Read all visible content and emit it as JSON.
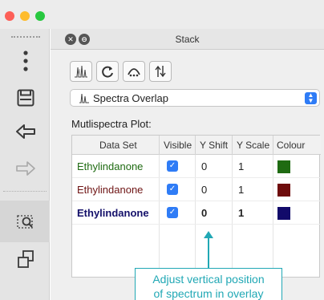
{
  "window": {
    "traffic_lights": [
      "close",
      "minimize",
      "zoom"
    ]
  },
  "left_toolbar": {
    "items": [
      {
        "name": "more",
        "icon": "vertical-dots-icon"
      },
      {
        "name": "save",
        "icon": "floppy-disk-icon"
      },
      {
        "name": "undo",
        "icon": "undo-arrow-icon"
      },
      {
        "name": "redo",
        "icon": "redo-arrow-icon"
      },
      {
        "name": "zoom-window",
        "icon": "zoom-region-icon"
      },
      {
        "name": "stack",
        "icon": "stacked-windows-icon"
      }
    ]
  },
  "panel": {
    "title": "Stack",
    "tools": [
      {
        "name": "spectra-overlay-tool",
        "icon": "overlay-spectra-icon"
      },
      {
        "name": "refresh-tool",
        "icon": "refresh-icon"
      },
      {
        "name": "peaks-tool",
        "icon": "peak-dots-icon"
      },
      {
        "name": "shift-tool",
        "icon": "vertical-shift-icon"
      }
    ],
    "mode_select": {
      "value": "Spectra Overlap",
      "icon": "spectra-overlap-icon"
    },
    "plot_label": "Mutlispectra Plot:",
    "table": {
      "columns": [
        "Data Set",
        "Visible",
        "Y Shift",
        "Y Scale",
        "Colour"
      ],
      "rows": [
        {
          "data_set": "Ethylindanone",
          "visible": true,
          "y_shift": "0",
          "y_scale": "1",
          "colour": "#1f6b12",
          "text_color": "#1f6b12",
          "bold": false
        },
        {
          "data_set": "Ethylindanone",
          "visible": true,
          "y_shift": "0",
          "y_scale": "1",
          "colour": "#6e0c0c",
          "text_color": "#6e1414",
          "bold": false
        },
        {
          "data_set": "Ethylindanone",
          "visible": true,
          "y_shift": "0",
          "y_scale": "1",
          "colour": "#120a6a",
          "text_color": "#14106a",
          "bold": true
        }
      ]
    }
  },
  "annotation": {
    "line1": "Adjust vertical position",
    "line2": "of spectrum in overlay",
    "color": "#21a8b5"
  }
}
